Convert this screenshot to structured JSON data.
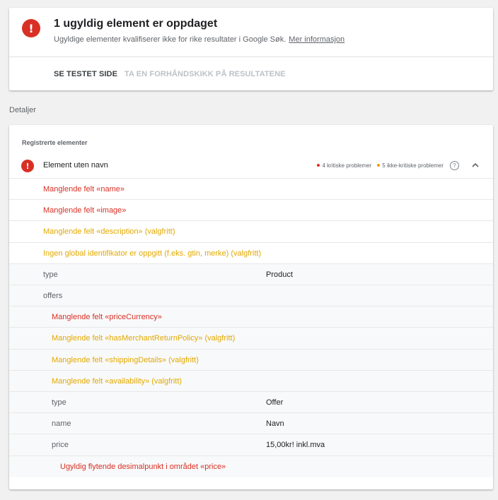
{
  "summary": {
    "title": "1 ugyldig element er oppdaget",
    "subtitle": "Ugyldige elementer kvalifiserer ikke for rike resultater i Google Søk.",
    "more_link": "Mer informasjon",
    "tabs": [
      "SE TESTET SIDE",
      "TA EN FORHÅNDSKIKK PÅ RESULTATENE"
    ]
  },
  "details_label": "Detaljer",
  "detected": {
    "section_label": "Registrerte elementer",
    "item_title": "Element uten navn",
    "critical_issues": "4 kritiske problemer",
    "noncritical_issues": "5 ikke-kritiske problemer",
    "colors": {
      "critical": "#d93025",
      "noncritical": "#f29900"
    },
    "icons": {
      "error": "error-icon",
      "help": "help-icon",
      "collapse": "chevron-up-icon"
    }
  },
  "rows": [
    {
      "kind": "error",
      "text": "Manglende felt «name»"
    },
    {
      "kind": "error",
      "text": "Manglende felt «image»"
    },
    {
      "kind": "warning",
      "text": "Manglende felt «description» (valgfritt)"
    },
    {
      "kind": "warning",
      "text": "Ingen global identifikator er oppgitt (f.eks. gtin, merke) (valgfritt)"
    },
    {
      "kind": "prop",
      "key": "type",
      "value": "Product"
    },
    {
      "kind": "prop",
      "key": "offers",
      "value": ""
    },
    {
      "kind": "error",
      "text": "Manglende felt «priceCurrency»"
    },
    {
      "kind": "warning",
      "text": "Manglende felt «hasMerchantReturnPolicy» (valgfritt)"
    },
    {
      "kind": "warning",
      "text": "Manglende felt «shippingDetails» (valgfritt)"
    },
    {
      "kind": "warning",
      "text": "Manglende felt «availability» (valgfritt)"
    },
    {
      "kind": "prop",
      "key": "type",
      "value": "Offer"
    },
    {
      "kind": "prop",
      "key": "name",
      "value": "Navn"
    },
    {
      "kind": "prop",
      "key": "price",
      "value": "15,00kr! inkl.mva"
    },
    {
      "kind": "error",
      "text": "Ugyldig flytende desimalpunkt i området «price»"
    }
  ]
}
